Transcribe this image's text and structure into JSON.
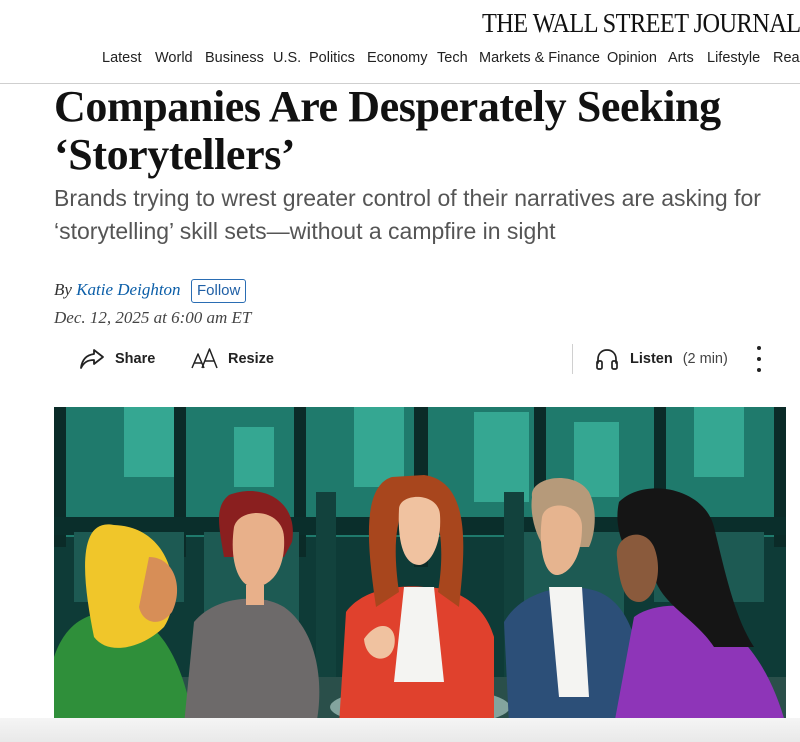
{
  "masthead": {
    "logo": "THE WALL STREET JOURNAL."
  },
  "nav": {
    "items": [
      "Latest",
      "World",
      "Business",
      "U.S.",
      "Politics",
      "Economy",
      "Tech",
      "Markets & Finance",
      "Opinion",
      "Arts",
      "Lifestyle",
      "Real"
    ]
  },
  "article": {
    "headline_line1": "Companies Are Desperately Seeking",
    "headline_line2": "‘Storytellers’",
    "dek_line1": "Brands trying to wrest greater control of their narratives are asking for",
    "dek_line2": "‘storytelling’ skill sets—without a campfire in sight",
    "byline_prefix": "By",
    "author": "Katie Deighton",
    "follow_label": "Follow",
    "date": "Dec. 12, 2025 at 6:00 am ET"
  },
  "toolbar": {
    "share_label": "Share",
    "resize_label": "Resize",
    "listen_label": "Listen",
    "listen_duration": "(2 min)"
  },
  "hero": {
    "icons": [
      "share-icon",
      "text-resize-icon",
      "headphones-icon",
      "more-vertical-icon"
    ],
    "colors": {
      "background": "#0e3b37",
      "city": "#2a9a86",
      "jacket_red": "#e0412d",
      "jacket_green": "#2f8f3a",
      "jacket_purple": "#8e35b8",
      "jacket_blue": "#2c4f78"
    }
  }
}
